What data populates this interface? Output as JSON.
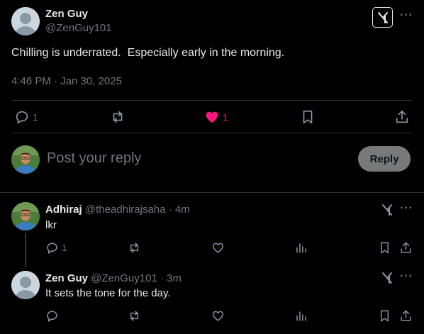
{
  "main_post": {
    "display_name": "Zen Guy",
    "handle": "@ZenGuy101",
    "text": "Chilling is underrated.  Especially early in the morning.",
    "timestamp": "4:46 PM · Jan 30, 2025",
    "reply_count": "1",
    "like_count": "1",
    "like_color": "#f91880"
  },
  "compose": {
    "placeholder": "Post your reply",
    "reply_label": "Reply"
  },
  "replies": [
    {
      "display_name": "Adhiraj",
      "handle": "@theadhirajsaha",
      "sep": "·",
      "age": "4m",
      "text": "lkr",
      "reply_count": "1"
    },
    {
      "display_name": "Zen Guy",
      "handle": "@ZenGuy101",
      "sep": "·",
      "age": "3m",
      "text": "It sets the tone for the day."
    }
  ],
  "icons": {
    "grok": "grok-icon",
    "more": "more-icon",
    "reply": "reply-icon",
    "repost": "repost-icon",
    "like": "like-icon",
    "views": "views-icon",
    "bookmark": "bookmark-icon",
    "share": "share-icon"
  },
  "more_glyph": "···"
}
